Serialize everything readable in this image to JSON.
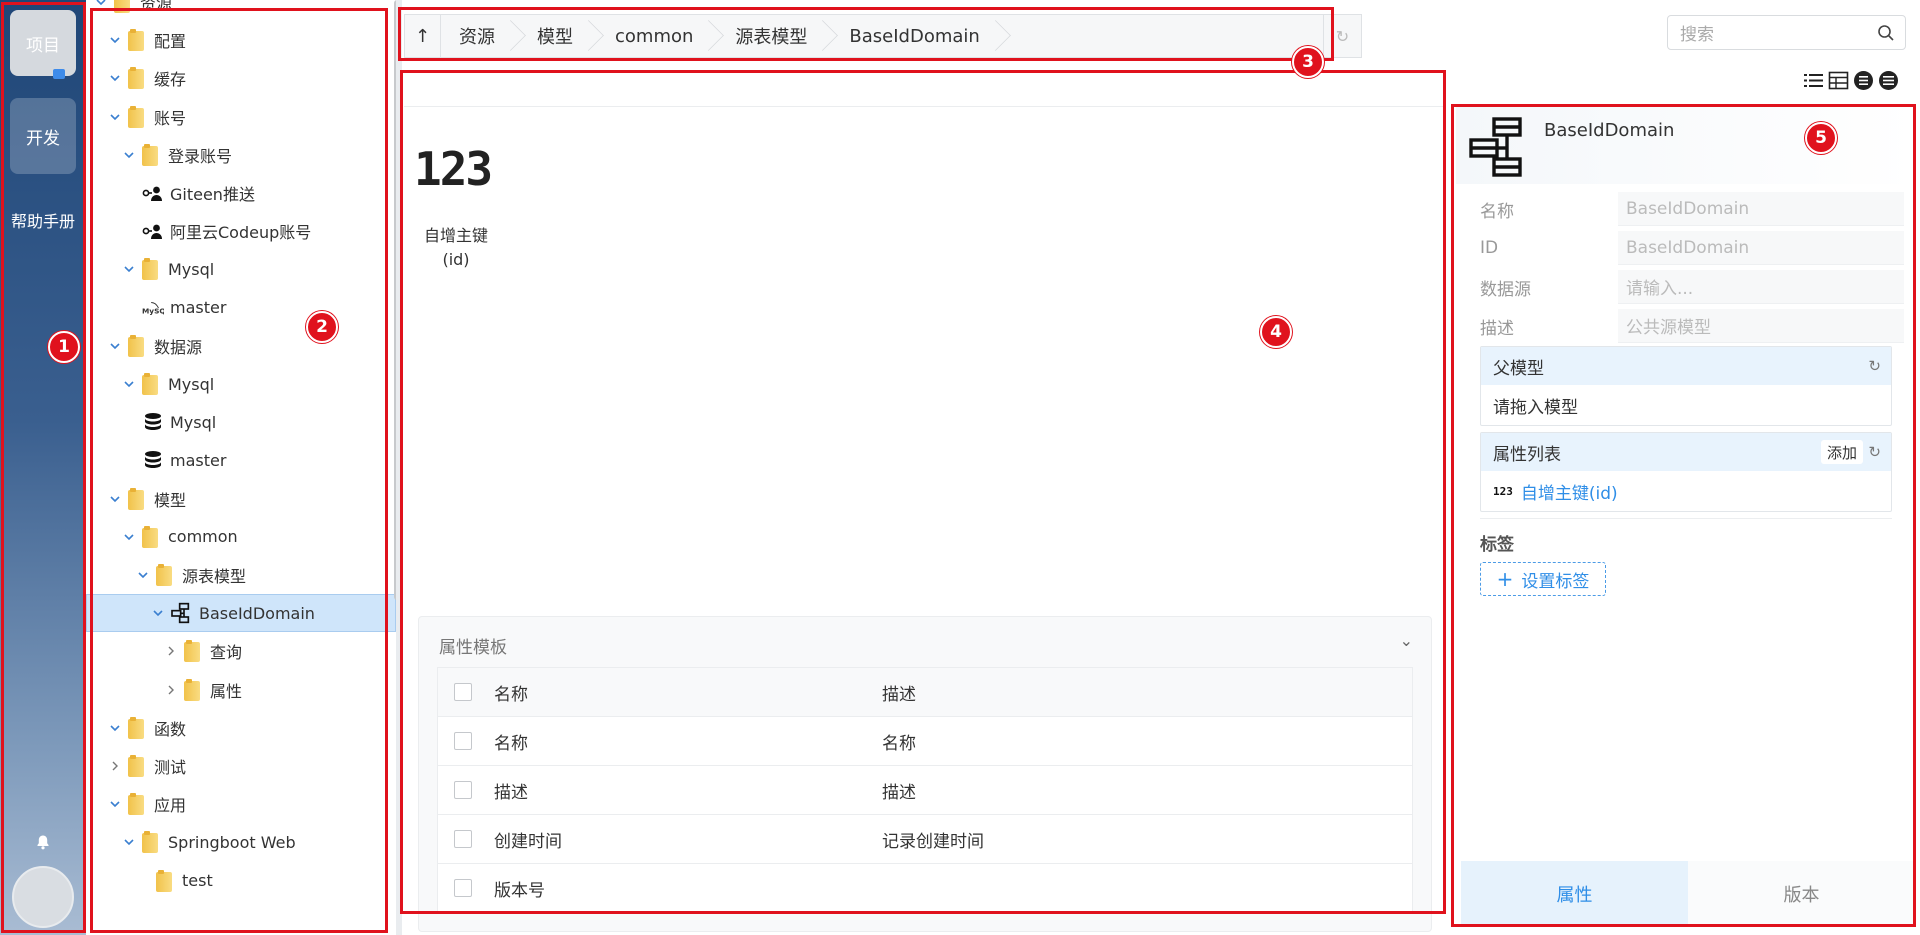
{
  "rail": {
    "projects_label": "项目",
    "dev_label": "开发",
    "help_label": "帮助手册"
  },
  "tree": {
    "nodes": [
      {
        "label": "资源",
        "icon": "folder-icon",
        "expanded": true,
        "level": 0
      },
      {
        "label": "配置",
        "icon": "folder-icon",
        "expanded": true,
        "level": 1
      },
      {
        "label": "缓存",
        "icon": "folder-icon",
        "expanded": true,
        "level": 1
      },
      {
        "label": "账号",
        "icon": "folder-icon",
        "expanded": true,
        "level": 1
      },
      {
        "label": "登录账号",
        "icon": "folder-icon",
        "expanded": true,
        "level": 2
      },
      {
        "label": "Giteen推送",
        "icon": "account-icon",
        "level": 2
      },
      {
        "label": "阿里云Codeup账号",
        "icon": "account-icon",
        "level": 2
      },
      {
        "label": "Mysql",
        "icon": "folder-icon",
        "expanded": true,
        "level": 2
      },
      {
        "label": "master",
        "icon": "mysql-icon",
        "level": 2
      },
      {
        "label": "数据源",
        "icon": "folder-icon",
        "expanded": true,
        "level": 1
      },
      {
        "label": "Mysql",
        "icon": "folder-icon",
        "expanded": true,
        "level": 2
      },
      {
        "label": "Mysql",
        "icon": "database-icon",
        "level": 2
      },
      {
        "label": "master",
        "icon": "database-icon",
        "level": 2
      },
      {
        "label": "模型",
        "icon": "folder-icon",
        "expanded": true,
        "level": 1
      },
      {
        "label": "common",
        "icon": "folder-icon",
        "expanded": true,
        "level": 2
      },
      {
        "label": "源表模型",
        "icon": "folder-icon",
        "expanded": true,
        "level": 3
      },
      {
        "label": "BaseIdDomain",
        "icon": "model-icon",
        "expanded": true,
        "level": 4,
        "selected": true
      },
      {
        "label": "查询",
        "icon": "folder-icon",
        "expanded": false,
        "level": 5
      },
      {
        "label": "属性",
        "icon": "folder-icon",
        "expanded": false,
        "level": 5
      },
      {
        "label": "函数",
        "icon": "folder-icon",
        "expanded": true,
        "level": 1
      },
      {
        "label": "测试",
        "icon": "folder-icon",
        "expanded": false,
        "level": 1
      },
      {
        "label": "应用",
        "icon": "folder-icon",
        "expanded": true,
        "level": 1
      },
      {
        "label": "Springboot Web",
        "icon": "folder-icon",
        "expanded": true,
        "level": 2
      },
      {
        "label": "test",
        "icon": "folder-icon",
        "level": 3
      }
    ]
  },
  "breadcrumb": {
    "up_icon": "arrow-up-icon",
    "items": [
      "资源",
      "模型",
      "common",
      "源表模型",
      "BaseIdDomain"
    ],
    "refresh_icon": "refresh-icon"
  },
  "canvas": {
    "field_icon_text": "123",
    "field_label_line1": "自增主键",
    "field_label_line2": "(id)"
  },
  "template": {
    "title": "属性模板",
    "columns": [
      "名称",
      "描述"
    ],
    "rows": [
      {
        "name": "名称",
        "desc": "名称"
      },
      {
        "name": "描述",
        "desc": "描述"
      },
      {
        "name": "创建时间",
        "desc": "记录创建时间"
      },
      {
        "name": "版本号",
        "desc": ""
      }
    ]
  },
  "search": {
    "placeholder": "搜索"
  },
  "props": {
    "title": "BaseIdDomain",
    "fields": [
      {
        "label": "名称",
        "value": "BaseIdDomain"
      },
      {
        "label": "ID",
        "value": "BaseIdDomain"
      },
      {
        "label": "数据源",
        "value": "请输入..."
      },
      {
        "label": "描述",
        "value": "公共源模型"
      }
    ],
    "parent_title": "父模型",
    "parent_placeholder": "请拖入模型",
    "attrs_title": "属性列表",
    "attrs_add": "添加",
    "attr_icon_text": "123",
    "attr_item": "自增主键(id)",
    "tags_title": "标签",
    "tags_button": "设置标签",
    "tab_props": "属性",
    "tab_version": "版本"
  },
  "annotations": [
    "1",
    "2",
    "3",
    "4",
    "5"
  ],
  "colors": {
    "annotation": "#e0121d",
    "accent": "#2f8ee7",
    "selection": "#cfe5fa"
  }
}
